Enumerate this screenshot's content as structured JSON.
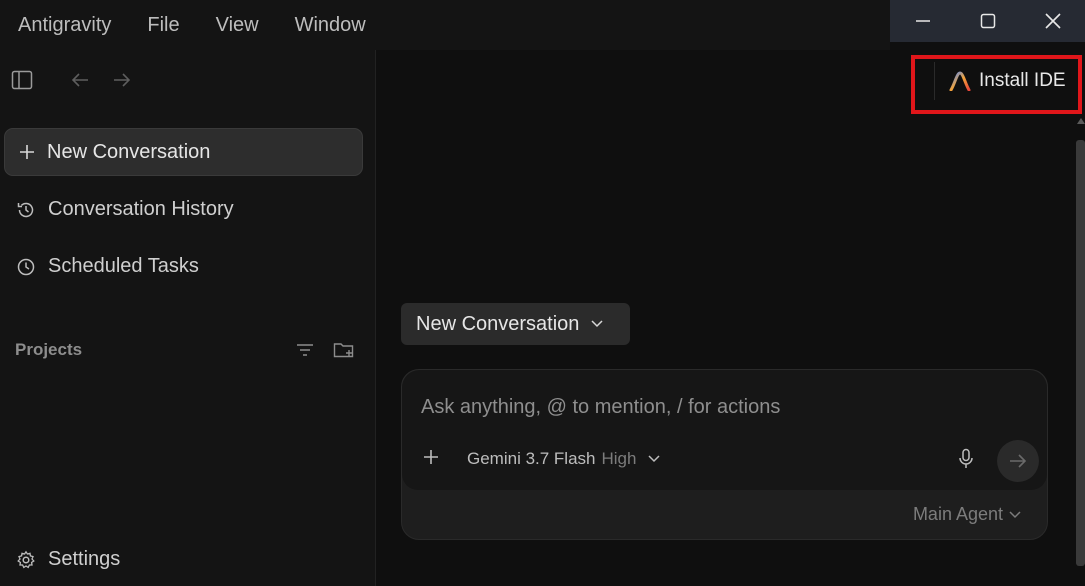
{
  "menubar": {
    "items": [
      "Antigravity",
      "File",
      "View",
      "Window"
    ]
  },
  "sidebar": {
    "new_conversation": "New Conversation",
    "conversation_history": "Conversation History",
    "scheduled_tasks": "Scheduled Tasks",
    "projects_label": "Projects",
    "settings": "Settings"
  },
  "main": {
    "install_ide": "Install IDE",
    "conversation_dropdown": "New Conversation",
    "composer": {
      "placeholder": "Ask anything, @ to mention, / for actions",
      "model_name": "Gemini 3.7 Flash",
      "model_level": "High",
      "agent": "Main Agent"
    }
  },
  "colors": {
    "highlight": "#e0161a",
    "background": "#0f0f0f",
    "sidebar": "#141414"
  }
}
